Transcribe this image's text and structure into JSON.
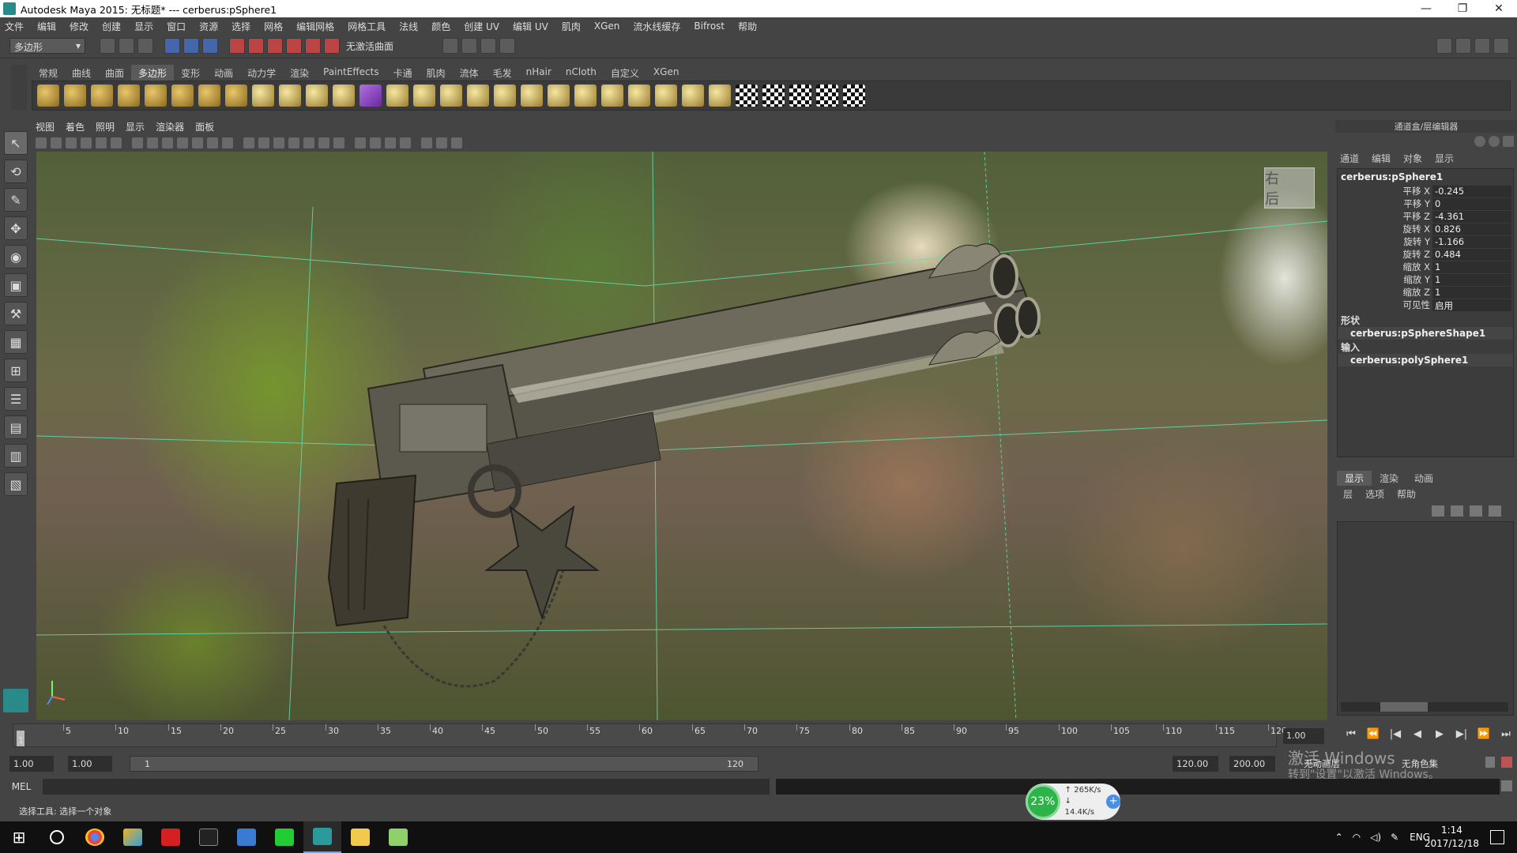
{
  "window": {
    "title": "Autodesk Maya 2015: 无标题*   ---   cerberus:pSphere1",
    "controls": [
      "—",
      "❐",
      "✕"
    ]
  },
  "menubar": [
    "文件",
    "编辑",
    "修改",
    "创建",
    "显示",
    "窗口",
    "资源",
    "选择",
    "网格",
    "编辑网格",
    "网格工具",
    "法线",
    "颜色",
    "创建 UV",
    "编辑 UV",
    "肌肉",
    "XGen",
    "流水线缓存",
    "Bifrost",
    "帮助"
  ],
  "statusline": {
    "menuset": "多边形",
    "live_surface": "无激活曲面"
  },
  "shelf": {
    "tabs": [
      "常规",
      "曲线",
      "曲面",
      "多边形",
      "变形",
      "动画",
      "动力学",
      "渲染",
      "PaintEffects",
      "卡通",
      "肌肉",
      "流体",
      "毛发",
      "nHair",
      "nCloth",
      "自定义",
      "XGen"
    ],
    "active_tab": "多边形"
  },
  "viewport": {
    "menu": [
      "视图",
      "着色",
      "照明",
      "显示",
      "渲染器",
      "面板"
    ],
    "viewcube_label": "右 后"
  },
  "channel_box": {
    "title": "通道盒/层编辑器",
    "tabs": [
      "通道",
      "编辑",
      "对象",
      "显示"
    ],
    "object": "cerberus:pSphere1",
    "attributes": [
      {
        "name": "平移 X",
        "value": "-0.245"
      },
      {
        "name": "平移 Y",
        "value": "0"
      },
      {
        "name": "平移 Z",
        "value": "-4.361"
      },
      {
        "name": "旋转 X",
        "value": "0.826"
      },
      {
        "name": "旋转 Y",
        "value": "-1.166"
      },
      {
        "name": "旋转 Z",
        "value": "0.484"
      },
      {
        "name": "缩放 X",
        "value": "1"
      },
      {
        "name": "缩放 Y",
        "value": "1"
      },
      {
        "name": "缩放 Z",
        "value": "1"
      },
      {
        "name": "可见性",
        "value": "启用"
      }
    ],
    "shapes_label": "形状",
    "shape_node": "cerberus:pSphereShape1",
    "inputs_label": "输入",
    "input_node": "cerberus:polySphere1"
  },
  "layer_editor": {
    "tabs": [
      "显示",
      "渲染",
      "动画"
    ],
    "active_tab": "显示",
    "menu": [
      "层",
      "选项",
      "帮助"
    ]
  },
  "timeline": {
    "ticks": [
      "5",
      "10",
      "15",
      "20",
      "25",
      "30",
      "35",
      "40",
      "45",
      "50",
      "55",
      "60",
      "65",
      "70",
      "75",
      "80",
      "85",
      "90",
      "95",
      "100",
      "105",
      "110",
      "115",
      "120"
    ],
    "start_marker": "1",
    "current_frame": "1.00",
    "playback": [
      "⏮",
      "⏪",
      "|◀",
      "◀",
      "▶",
      "▶|",
      "⏩",
      "⏭"
    ]
  },
  "range": {
    "start": "1.00",
    "inner_start": "1.00",
    "slider_start": "1",
    "slider_end": "120",
    "end": "120.00",
    "outer_end": "200.00",
    "anim_layer": "无动画层",
    "char_set": "无角色集"
  },
  "command": {
    "label": "MEL",
    "help": "选择工具: 选择一个对象"
  },
  "activation": {
    "line1": "激活 Windows",
    "line2": "转到\"设置\"以激活 Windows。"
  },
  "perf_widget": {
    "percent": "23%",
    "up": "265K/s",
    "down": "14.4K/s"
  },
  "taskbar": {
    "lang": "ENG",
    "time": "1:14",
    "date": "2017/12/18"
  }
}
